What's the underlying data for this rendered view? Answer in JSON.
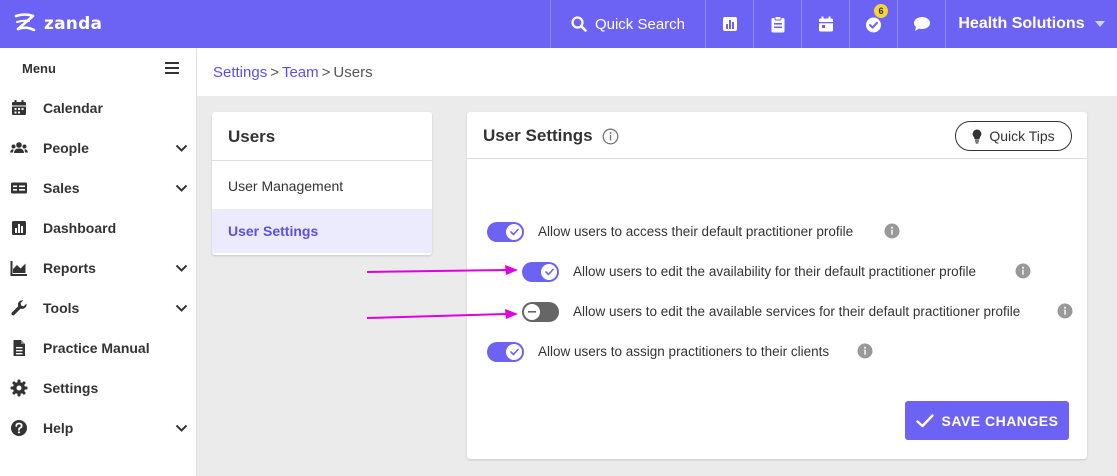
{
  "app": {
    "brand": "zanda",
    "accent_color": "#6c63f4",
    "highlight_color": "#e000e0"
  },
  "topbar": {
    "search_label": "Quick Search",
    "icons": [
      "reports-icon",
      "clipboard-icon",
      "calendar-icon",
      "tasks-check-icon",
      "chat-icon"
    ],
    "tasks_badge": "6",
    "account_name": "Health Solutions"
  },
  "sidebar": {
    "menu_title": "Menu",
    "items": [
      {
        "label": "Calendar",
        "icon": "calendar-icon",
        "has_submenu": false
      },
      {
        "label": "People",
        "icon": "people-icon",
        "has_submenu": true
      },
      {
        "label": "Sales",
        "icon": "sales-icon",
        "has_submenu": true
      },
      {
        "label": "Dashboard",
        "icon": "dashboard-icon",
        "has_submenu": false
      },
      {
        "label": "Reports",
        "icon": "reports-icon",
        "has_submenu": true
      },
      {
        "label": "Tools",
        "icon": "wrench-icon",
        "has_submenu": true
      },
      {
        "label": "Practice Manual",
        "icon": "document-icon",
        "has_submenu": false
      },
      {
        "label": "Settings",
        "icon": "gear-icon",
        "has_submenu": false
      },
      {
        "label": "Help",
        "icon": "help-icon",
        "has_submenu": true
      }
    ]
  },
  "breadcrumb": {
    "items": [
      "Settings",
      "Team",
      "Users"
    ],
    "separator": ">"
  },
  "users_menu": {
    "title": "Users",
    "items": [
      {
        "label": "User Management",
        "active": false
      },
      {
        "label": "User Settings",
        "active": true
      }
    ]
  },
  "user_settings": {
    "title": "User Settings",
    "quick_tips_label": "Quick Tips",
    "options": [
      {
        "label": "Allow users to access their default practitioner profile",
        "enabled": true
      },
      {
        "label": "Allow users to edit the availability for their default practitioner profile",
        "enabled": true
      },
      {
        "label": "Allow users to edit the available services for their default practitioner profile",
        "enabled": false
      },
      {
        "label": "Allow users to assign practitioners to their clients",
        "enabled": true
      }
    ],
    "save_label": "SAVE CHANGES"
  }
}
